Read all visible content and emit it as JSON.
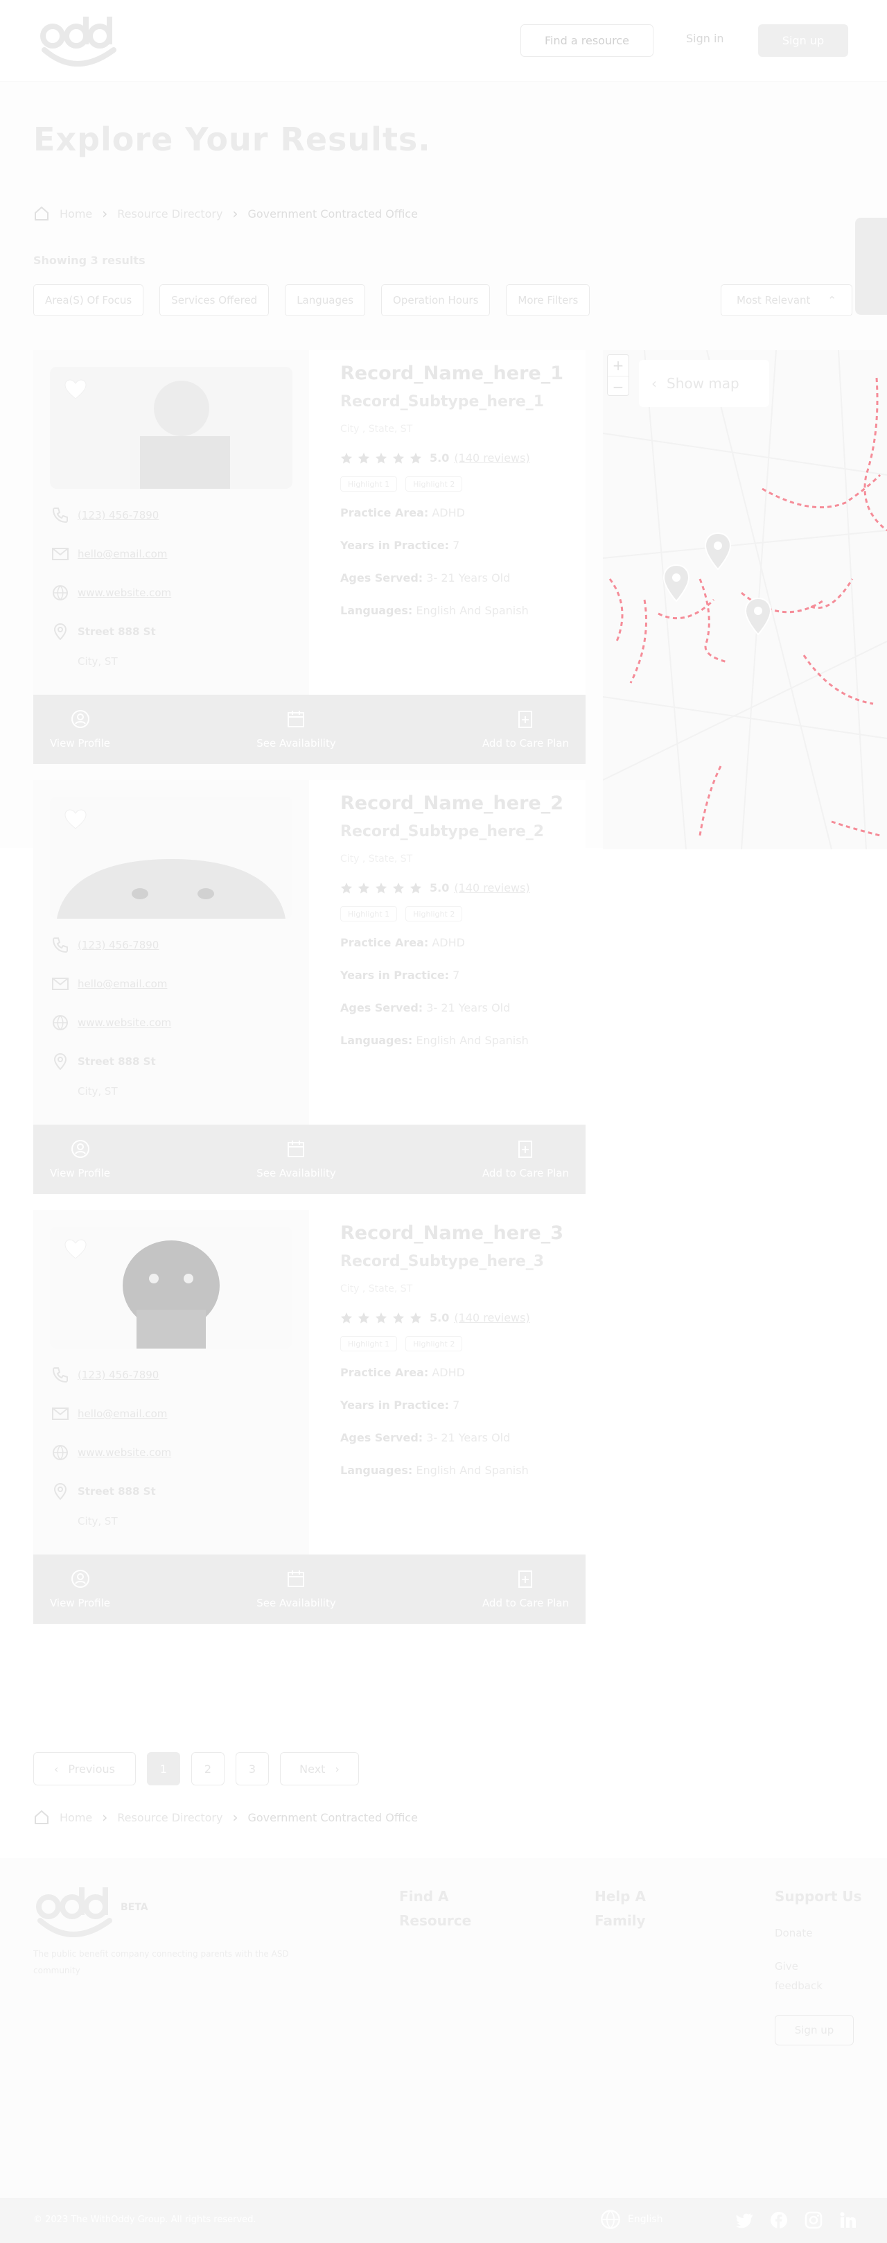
{
  "header": {
    "logo_text": "oddy",
    "find_resource": "Find a resource",
    "sign_in": "Sign in",
    "sign_up": "Sign up"
  },
  "page": {
    "title": "Explore Your Results.",
    "breadcrumb": [
      "Home",
      "Resource Directory",
      "Government Contracted Office"
    ],
    "showing": "Showing 3 results"
  },
  "filters": [
    "Area(S) Of Focus",
    "Services Offered",
    "Languages",
    "Operation Hours",
    "More Filters"
  ],
  "sort": {
    "selected": "Most Relevant"
  },
  "results": [
    {
      "name": "Record_Name_here_1",
      "subtype": "Record_Subtype_here_1",
      "city_state": "City , State, ST",
      "score": "5.0",
      "reviews": "(140 reviews)",
      "highlights": [
        "Highlight 1",
        "Highlight 2"
      ],
      "phone": "(123) 456-7890",
      "email": "hello@email.com",
      "website": "www.website.com",
      "street": "Street 888 St",
      "city": "City, ST",
      "practice_area_label": "Practice Area:",
      "practice_area": "ADHD",
      "years_label": "Years in Practice:",
      "years": "7",
      "ages_label": "Ages Served:",
      "ages": "3- 21 Years Old",
      "languages_label": "Languages:",
      "languages": "English And Spanish"
    },
    {
      "name": "Record_Name_here_2",
      "subtype": "Record_Subtype_here_2",
      "city_state": "City , State, ST",
      "score": "5.0",
      "reviews": "(140 reviews)",
      "highlights": [
        "Highlight 1",
        "Highlight 2"
      ],
      "phone": "(123) 456-7890",
      "email": "hello@email.com",
      "website": "www.website.com",
      "street": "Street 888 St",
      "city": "City, ST",
      "practice_area_label": "Practice Area:",
      "practice_area": "ADHD",
      "years_label": "Years in Practice:",
      "years": "7",
      "ages_label": "Ages Served:",
      "ages": "3- 21 Years Old",
      "languages_label": "Languages:",
      "languages": "English And Spanish"
    },
    {
      "name": "Record_Name_here_3",
      "subtype": "Record_Subtype_here_3",
      "city_state": "City , State, ST",
      "score": "5.0",
      "reviews": "(140 reviews)",
      "highlights": [
        "Highlight 1",
        "Highlight 2"
      ],
      "phone": "(123) 456-7890",
      "email": "hello@email.com",
      "website": "www.website.com",
      "street": "Street 888 St",
      "city": "City, ST",
      "practice_area_label": "Practice Area:",
      "practice_area": "ADHD",
      "years_label": "Years in Practice:",
      "years": "7",
      "ages_label": "Ages Served:",
      "ages": "3- 21 Years Old",
      "languages_label": "Languages:",
      "languages": "English And Spanish"
    }
  ],
  "actions": {
    "view_profile": "View Profile",
    "see_availability": "See Availability",
    "add_to_care_plan": "Add to Care Plan"
  },
  "map": {
    "show_map": "Show map",
    "zoom_in": "+",
    "zoom_out": "−"
  },
  "pagination": {
    "previous": "Previous",
    "pages": [
      "1",
      "2",
      "3"
    ],
    "next": "Next",
    "active": "1"
  },
  "footer": {
    "logo_text": "oddy",
    "beta": "BETA",
    "tagline": "The public benefit company connecting parents with the ASD community",
    "find_a": "Find A",
    "resource": "Resource",
    "help_a": "Help A",
    "family": "Family",
    "support_us": "Support Us",
    "donate": "Donate",
    "give": "Give",
    "feedback": "feedback",
    "sign_up": "Sign up",
    "copyright": "© 2023 The WithOddy Group. All rights reserved.",
    "language": "English"
  },
  "colors": {
    "overlay": "#ffffff",
    "action_bar": "#d8d8d8",
    "map_roads": "#e8001c"
  }
}
